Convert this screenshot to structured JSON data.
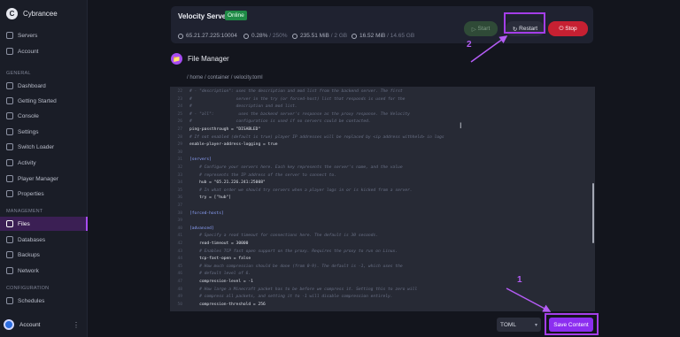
{
  "brand": {
    "name": "Cybrancee",
    "logo": "C"
  },
  "sidebar": {
    "top_items": [
      {
        "label": "Servers",
        "icon": "server-icon"
      },
      {
        "label": "Account",
        "icon": "user-icon"
      }
    ],
    "general_label": "GENERAL",
    "general_items": [
      {
        "label": "Dashboard",
        "icon": "dashboard-icon"
      },
      {
        "label": "Getting Started",
        "icon": "rocket-icon"
      },
      {
        "label": "Console",
        "icon": "terminal-icon"
      },
      {
        "label": "Settings",
        "icon": "gear-icon"
      },
      {
        "label": "Switch Loader",
        "icon": "switch-icon"
      },
      {
        "label": "Activity",
        "icon": "activity-icon"
      },
      {
        "label": "Player Manager",
        "icon": "players-icon"
      },
      {
        "label": "Properties",
        "icon": "properties-icon"
      }
    ],
    "management_label": "MANAGEMENT",
    "management_items": [
      {
        "label": "Files",
        "icon": "folder-icon",
        "active": true
      },
      {
        "label": "Databases",
        "icon": "database-icon"
      },
      {
        "label": "Backups",
        "icon": "backup-icon"
      },
      {
        "label": "Network",
        "icon": "network-icon"
      }
    ],
    "configuration_label": "CONFIGURATION",
    "configuration_items": [
      {
        "label": "Schedules",
        "icon": "calendar-icon"
      }
    ],
    "account_label": "Account"
  },
  "server": {
    "name": "Velocity Server",
    "status": "Online",
    "ip": "65.21.27.225:10004",
    "cpu": "0.28%",
    "cpu_limit": "/ 250%",
    "memory": "235.51 MiB",
    "memory_limit": "/ 2 GB",
    "disk": "16.52 MiB",
    "disk_limit": "/ 14.65 GB",
    "start_label": "Start",
    "restart_label": "Restart",
    "stop_label": "Stop"
  },
  "file_manager": {
    "title": "File Manager",
    "breadcrumb": "/ home / container / velocity.toml"
  },
  "editor": {
    "lines": [
      {
        "n": "22",
        "text": "# - \"description\": uses the description and mod list from the backend server. The first",
        "kind": "comment"
      },
      {
        "n": "23",
        "text": "#                  server in the try (or forced-host) list that responds is used for the",
        "kind": "comment"
      },
      {
        "n": "24",
        "text": "#                  description and mod list.",
        "kind": "comment"
      },
      {
        "n": "25",
        "text": "# - \"all\":          uses the backend server's response as the proxy response. The Velocity",
        "kind": "comment"
      },
      {
        "n": "26",
        "text": "#                  configuration is used if no servers could be contacted.",
        "kind": "comment"
      },
      {
        "n": "27",
        "text": "ping-passthrough = \"DISABLED\"",
        "kind": "key"
      },
      {
        "n": "28",
        "text": "# If not enabled (default is true) player IP addresses will be replaced by <ip address withheld> in logs",
        "kind": "comment"
      },
      {
        "n": "29",
        "text": "enable-player-address-logging = true",
        "kind": "key"
      },
      {
        "n": "30",
        "text": "",
        "kind": "key"
      },
      {
        "n": "31",
        "text": "[servers]",
        "kind": "section"
      },
      {
        "n": "32",
        "text": "    # Configure your servers here. Each key represents the server's name, and the value",
        "kind": "comment"
      },
      {
        "n": "33",
        "text": "    # represents the IP address of the server to connect to.",
        "kind": "comment"
      },
      {
        "n": "34",
        "text": "    hub = \"65.21.226.241:25008\"",
        "kind": "key"
      },
      {
        "n": "35",
        "text": "    # In what order we should try servers when a player logs in or is kicked from a server.",
        "kind": "comment"
      },
      {
        "n": "36",
        "text": "    try = [\"hub\"]",
        "kind": "key"
      },
      {
        "n": "37",
        "text": "",
        "kind": "key"
      },
      {
        "n": "38",
        "text": "[forced-hosts]",
        "kind": "section"
      },
      {
        "n": "39",
        "text": "",
        "kind": "key"
      },
      {
        "n": "40",
        "text": "[advanced]",
        "kind": "section"
      },
      {
        "n": "41",
        "text": "    # Specify a read timeout for connections here. The default is 30 seconds.",
        "kind": "comment"
      },
      {
        "n": "42",
        "text": "    read-timeout = 30000",
        "kind": "key"
      },
      {
        "n": "43",
        "text": "    # Enables TCP fast open support on the proxy. Requires the proxy to run on Linux.",
        "kind": "comment"
      },
      {
        "n": "44",
        "text": "    tcp-fast-open = false",
        "kind": "key"
      },
      {
        "n": "45",
        "text": "    # How much compression should be done (from 0-9). The default is -1, which uses the",
        "kind": "comment"
      },
      {
        "n": "46",
        "text": "    # default level of 6.",
        "kind": "comment"
      },
      {
        "n": "47",
        "text": "    compression-level = -1",
        "kind": "key"
      },
      {
        "n": "48",
        "text": "    # How large a Minecraft packet has to be before we compress it. Setting this to zero will",
        "kind": "comment"
      },
      {
        "n": "49",
        "text": "    # compress all packets, and setting it to -1 will disable compression entirely.",
        "kind": "comment"
      },
      {
        "n": "50",
        "text": "    compression-threshold = 256",
        "kind": "key"
      }
    ]
  },
  "footer": {
    "language": "TOML",
    "save_label": "Save Content"
  },
  "annotations": {
    "one": "1",
    "two": "2"
  },
  "colors": {
    "accent": "#a74cf1",
    "online": "#1f8a46",
    "stop": "#c62032",
    "save": "#8c2ef0"
  }
}
